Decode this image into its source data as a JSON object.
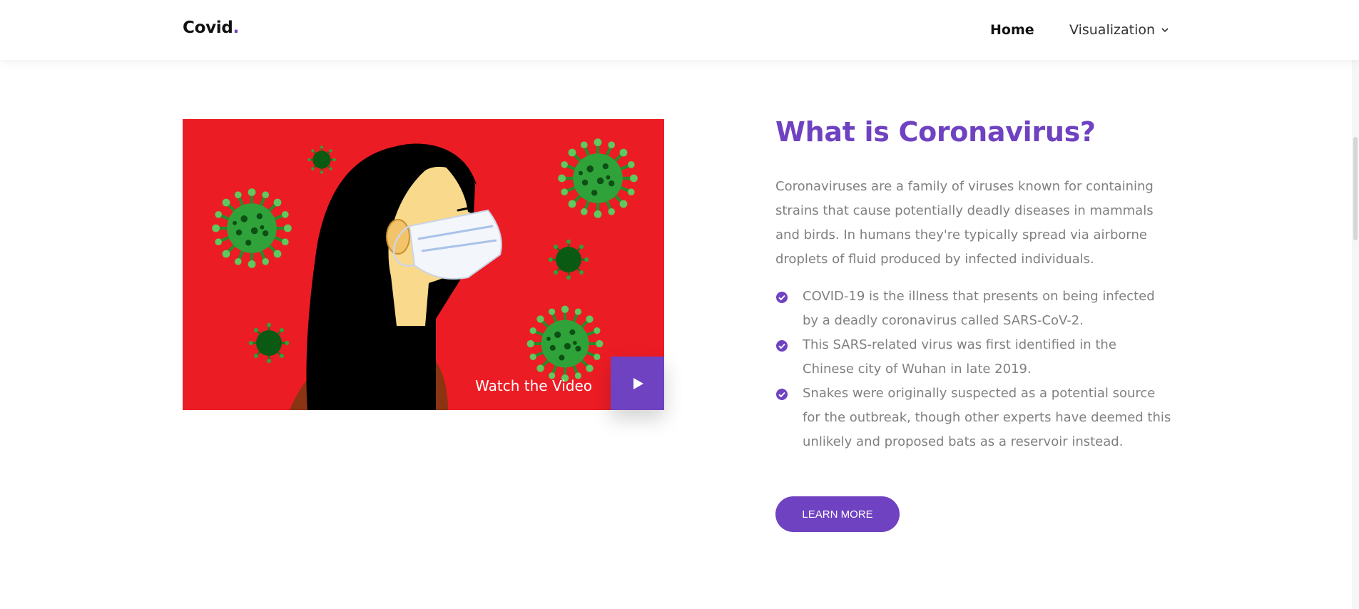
{
  "nav": {
    "brand_text": "Covid",
    "brand_dot": ".",
    "items": [
      {
        "label": "Home",
        "active": true
      },
      {
        "label": "Visualization",
        "has_dropdown": true,
        "icon": "chevron-down-icon"
      }
    ]
  },
  "video": {
    "watch_label": "Watch the Video",
    "play_icon": "play-icon",
    "background_color": "#ec1c24",
    "button_color": "#6f42c1"
  },
  "about": {
    "title": "What is Coronavirus?",
    "paragraph": "Coronaviruses are a family of viruses known for containing strains that cause potentially deadly diseases in mammals and birds. In humans they're typically spread via airborne droplets of fluid produced by infected individuals.",
    "points": [
      "COVID-19 is the illness that presents on being infected by a deadly coronavirus called SARS-CoV-2.",
      "This SARS-related virus was first identified in the Chinese city of Wuhan in late 2019.",
      "Snakes were originally suspected as a potential source for the outbreak, though other experts have deemed this unlikely and proposed bats as a reservoir instead."
    ],
    "check_icon": "check-circle-icon",
    "button_label": "Learn More"
  },
  "colors": {
    "accent": "#6f42c1",
    "text_muted": "#808080",
    "video_bg": "#ec1c24"
  }
}
